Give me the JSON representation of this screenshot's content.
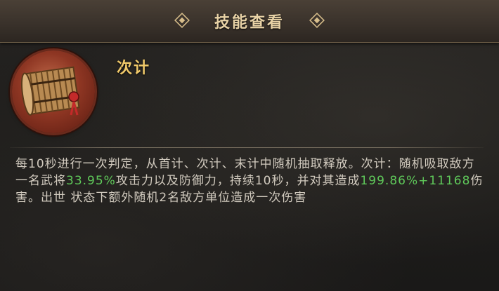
{
  "header": {
    "title": "技能查看"
  },
  "skill": {
    "name": "次计",
    "icon": "scroll-bundle-icon",
    "description": {
      "p1": "每10秒进行一次判定，从首计、次计、末计中随机抽取释放。次计：随机吸取敌方一名武将",
      "v1": "33.95%",
      "p2": "攻击力以及防御力，持续10秒，并对其造成",
      "v2": "199.86%+11168",
      "p3": "伤害。出世 状态下额外随机2名敌方单位造成一次伤害"
    }
  },
  "colors": {
    "title": "#e8d2a6",
    "skill_name": "#f0c96a",
    "highlight": "#5fc95a",
    "body_text": "#d2cbbf"
  }
}
